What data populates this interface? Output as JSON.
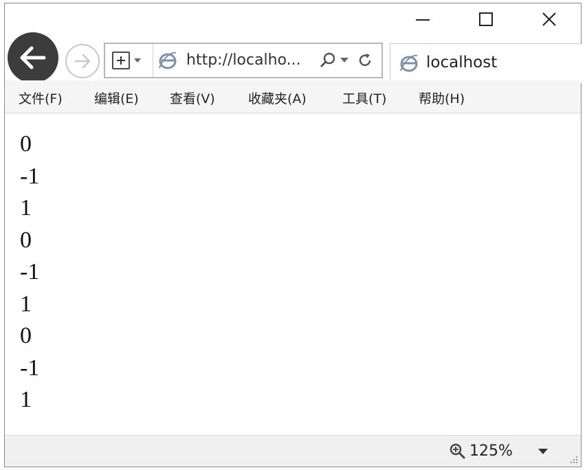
{
  "browser": {
    "address_url": "http://localho...",
    "tab_title": "localhost",
    "zoom_label": "125%"
  },
  "menu": [
    {
      "label": "文件(F)"
    },
    {
      "label": "编辑(E)"
    },
    {
      "label": "查看(V)"
    },
    {
      "label": "收藏夹(A)"
    },
    {
      "label": "工具(T)"
    },
    {
      "label": "帮助(H)"
    }
  ],
  "content": {
    "lines": [
      "0",
      "-1",
      "1",
      "0",
      "-1",
      "1",
      "0",
      "-1",
      "1"
    ]
  },
  "icons": {
    "back": "back-arrow-icon",
    "forward": "forward-arrow-icon",
    "compat": "compatibility-view-icon",
    "ie": "ie-logo-icon",
    "search": "search-icon",
    "refresh": "refresh-icon",
    "zoom": "zoom-icon",
    "minimize": "minimize-icon",
    "maximize": "maximize-icon",
    "close": "close-icon"
  },
  "colors": {
    "back_button": "#3c3c3c",
    "ie_blue": "#7a8fa8"
  }
}
